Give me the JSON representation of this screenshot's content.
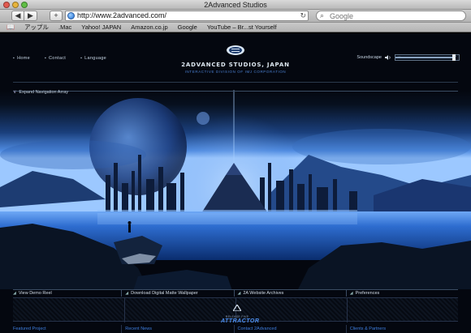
{
  "window": {
    "title": "2Advanced Studios"
  },
  "toolbar": {
    "back_glyph": "◀",
    "forward_glyph": "▶",
    "add_glyph": "+",
    "url": "http://www.2advanced.com/",
    "reload_glyph": "↻",
    "search_placeholder": "Google",
    "search_glyph": "⌕"
  },
  "bookmarks": {
    "book_glyph": "📖",
    "items": [
      "アップル",
      ".Mac",
      "Yahoo! JAPAN",
      "Amazon.co.jp",
      "Google",
      "YouTube – Br...st Yourself"
    ]
  },
  "site": {
    "nav": [
      "Home",
      "Contact",
      "Language"
    ],
    "logo": {
      "name": "2ADVANCED STUDIOS, JAPAN",
      "tagline": "INTERACTIVE DIVISION OF IMJ CORPORATION"
    },
    "soundscape": {
      "label": "Soundscape",
      "minus": "−",
      "plus": "+",
      "level": 0.95
    },
    "expand_label": "Expand Navigation Array",
    "expand_glyph": "∨",
    "bottom_links": [
      "View Demo Reel",
      "Download Digital Matte Wallpaper",
      "2A Website Archives",
      "Preferences"
    ],
    "attractor": {
      "release": "RELEASE FIVE",
      "name": "ATTRACTOR"
    },
    "footer_links": [
      "Featured Project",
      "Recent News",
      "Contact 2Advanced",
      "Clients & Partners"
    ]
  },
  "colors": {
    "accent_blue": "#3f7fe0",
    "sky_glow": "#3b7de0",
    "water": "#1f5fc0"
  }
}
